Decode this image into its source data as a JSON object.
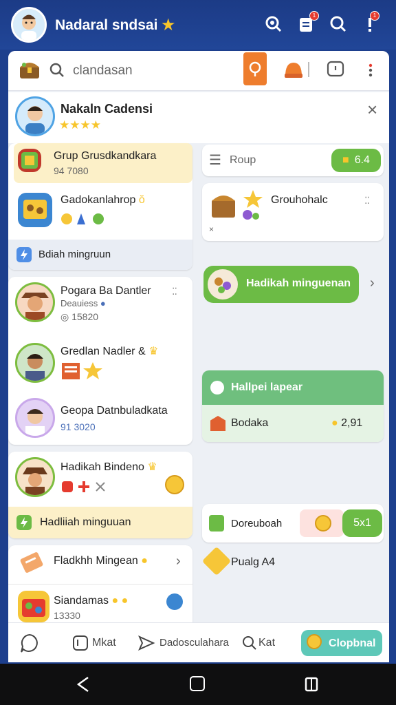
{
  "header": {
    "title": "Nadaral sndsai",
    "icons": [
      "search-user-icon",
      "clipboard-icon",
      "search-icon",
      "alert-icon"
    ],
    "badges": [
      "1",
      "1"
    ]
  },
  "search": {
    "placeholder": "clandasan"
  },
  "profile": {
    "name": "Nakaln Cadensi",
    "stars": "★★★★"
  },
  "left": {
    "group_highlight": {
      "title": "Grup Grusdkandkara",
      "count": "94 7080"
    },
    "item2": {
      "title": "Gadokanlahrop",
      "suffix": "ŏ"
    },
    "reward_link": "Bdiah mingruun",
    "list": [
      {
        "name": "Pogara Ba Dantler",
        "sub": "Deauiess",
        "meta": "15820"
      },
      {
        "name": "Gredlan Nadler &",
        "sub": "",
        "meta": ""
      },
      {
        "name": "Geopa Datnbuladkata",
        "sub": "",
        "meta": "91 3020"
      }
    ],
    "hadikah": {
      "name": "Hadikah Bindeno"
    },
    "yellow_banner": "Hadliiah minguuan",
    "fladkhh": "Fladkhh Mingean",
    "last": {
      "name": "Siandamas",
      "meta": "13330"
    }
  },
  "right": {
    "group_label": "Roup",
    "group_count": "6.4",
    "grouphak": "Grouhohalc",
    "close_x": "×",
    "green_button": "Hadikah minguenan",
    "green_card": {
      "title": "Hallpei lapear",
      "row_label": "Bodaka",
      "row_value": "2,91"
    },
    "small": {
      "label": "Doreuboah",
      "count": "5x1"
    },
    "pualg": "Pualg A4"
  },
  "bottom": {
    "items": [
      "",
      "Mkat",
      "Dadosculahara",
      "Kat"
    ],
    "action": "Clopbnal"
  },
  "colors": {
    "primary": "#1d3f8d",
    "green": "#6cbb45",
    "orange": "#ee7d2d",
    "yellow": "#fcf0c8"
  }
}
